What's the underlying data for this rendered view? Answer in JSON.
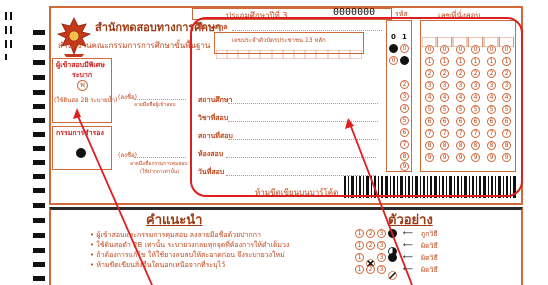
{
  "header": {
    "agency": "สำนักทดสอบทางการศึกษา",
    "office": "สำนักงานคณะกรรมการการศึกษาขั้นพื้นฐาน",
    "year_label": "ประถมศึกษาปีที่ 3",
    "code_value": "0000000",
    "code_label": "รหัส",
    "seat_label": "เลขที่นั่งสอบ"
  },
  "left_panel": {
    "special_label": "ผู้เข้าสอบมีพิเศษ",
    "level_label": "ระบาก",
    "level_mark": "พ",
    "pencil_note": "(ใช้ดินสอ 2B ระบายน้ำ)",
    "absent_label": "กรรมการสำรอง",
    "sign1_label": "(ลงชื่อ)",
    "sign1_sub": "ลายมือชื่อผู้เข้าสอบ",
    "sign2_label": "(ลงชื่อ)",
    "sign2_sub": "ลายมือชื่อกรรมการคุมสอบ",
    "sign2_note": "(ใช้ปากกาเท่านั้น)"
  },
  "form": {
    "name_label": "ชื่อ - สกุล",
    "id_hint": "เลขประจำตัวบัตรประชาชน 13 หลัก",
    "school_label": "สถานศึกษา",
    "district_label": "วิชาที่สอบ",
    "center_label": "สถานที่สอบ",
    "room_label": "ห้องสอบ",
    "date_label": "วันที่สอบ",
    "barcode_note": "ห้ามขีดเขียนบนบาร์โค้ด"
  },
  "code_columns": [
    "0",
    "1"
  ],
  "digits": [
    "0",
    "1",
    "2",
    "3",
    "4",
    "5",
    "6",
    "7",
    "8",
    "9"
  ],
  "instructions": {
    "title": "คำแนะนำ",
    "example_title": "ตัวอย่าง",
    "items": [
      "ผู้เข้าสอบและกรรมการคุมสอบ ลงลายมือชื่อด้วยปากกา",
      "ใช้ดินสอดำ 2B เท่านั้น ระบายวงกลมทุกจุดที่ต้องการให้ดำเต็มวง",
      "ถ้าต้องการแก้ไข ให้ใช้ยางลบลบให้สะอาดก่อน จึงระบายวงใหม่",
      "ห้ามขีดเขียนสิ่งอื่นใดนอกเหนือจากที่ระบุไว้"
    ],
    "examples": [
      {
        "bubbles": [
          "1",
          "2",
          "3"
        ],
        "result": "ถูกวิธี"
      },
      {
        "bubbles": [
          "1",
          "2",
          "3"
        ],
        "result": "ผิดวิธี"
      },
      {
        "bubbles": [
          "1",
          "2",
          "3"
        ],
        "result": "ผิดวิธี"
      },
      {
        "bubbles": [
          "1",
          "2",
          "3"
        ],
        "result": "ผิดวิธี"
      }
    ]
  },
  "colors": {
    "form_orange": "#c0461b",
    "highlight_red": "#dd1f1f",
    "ink_black": "#111111"
  }
}
